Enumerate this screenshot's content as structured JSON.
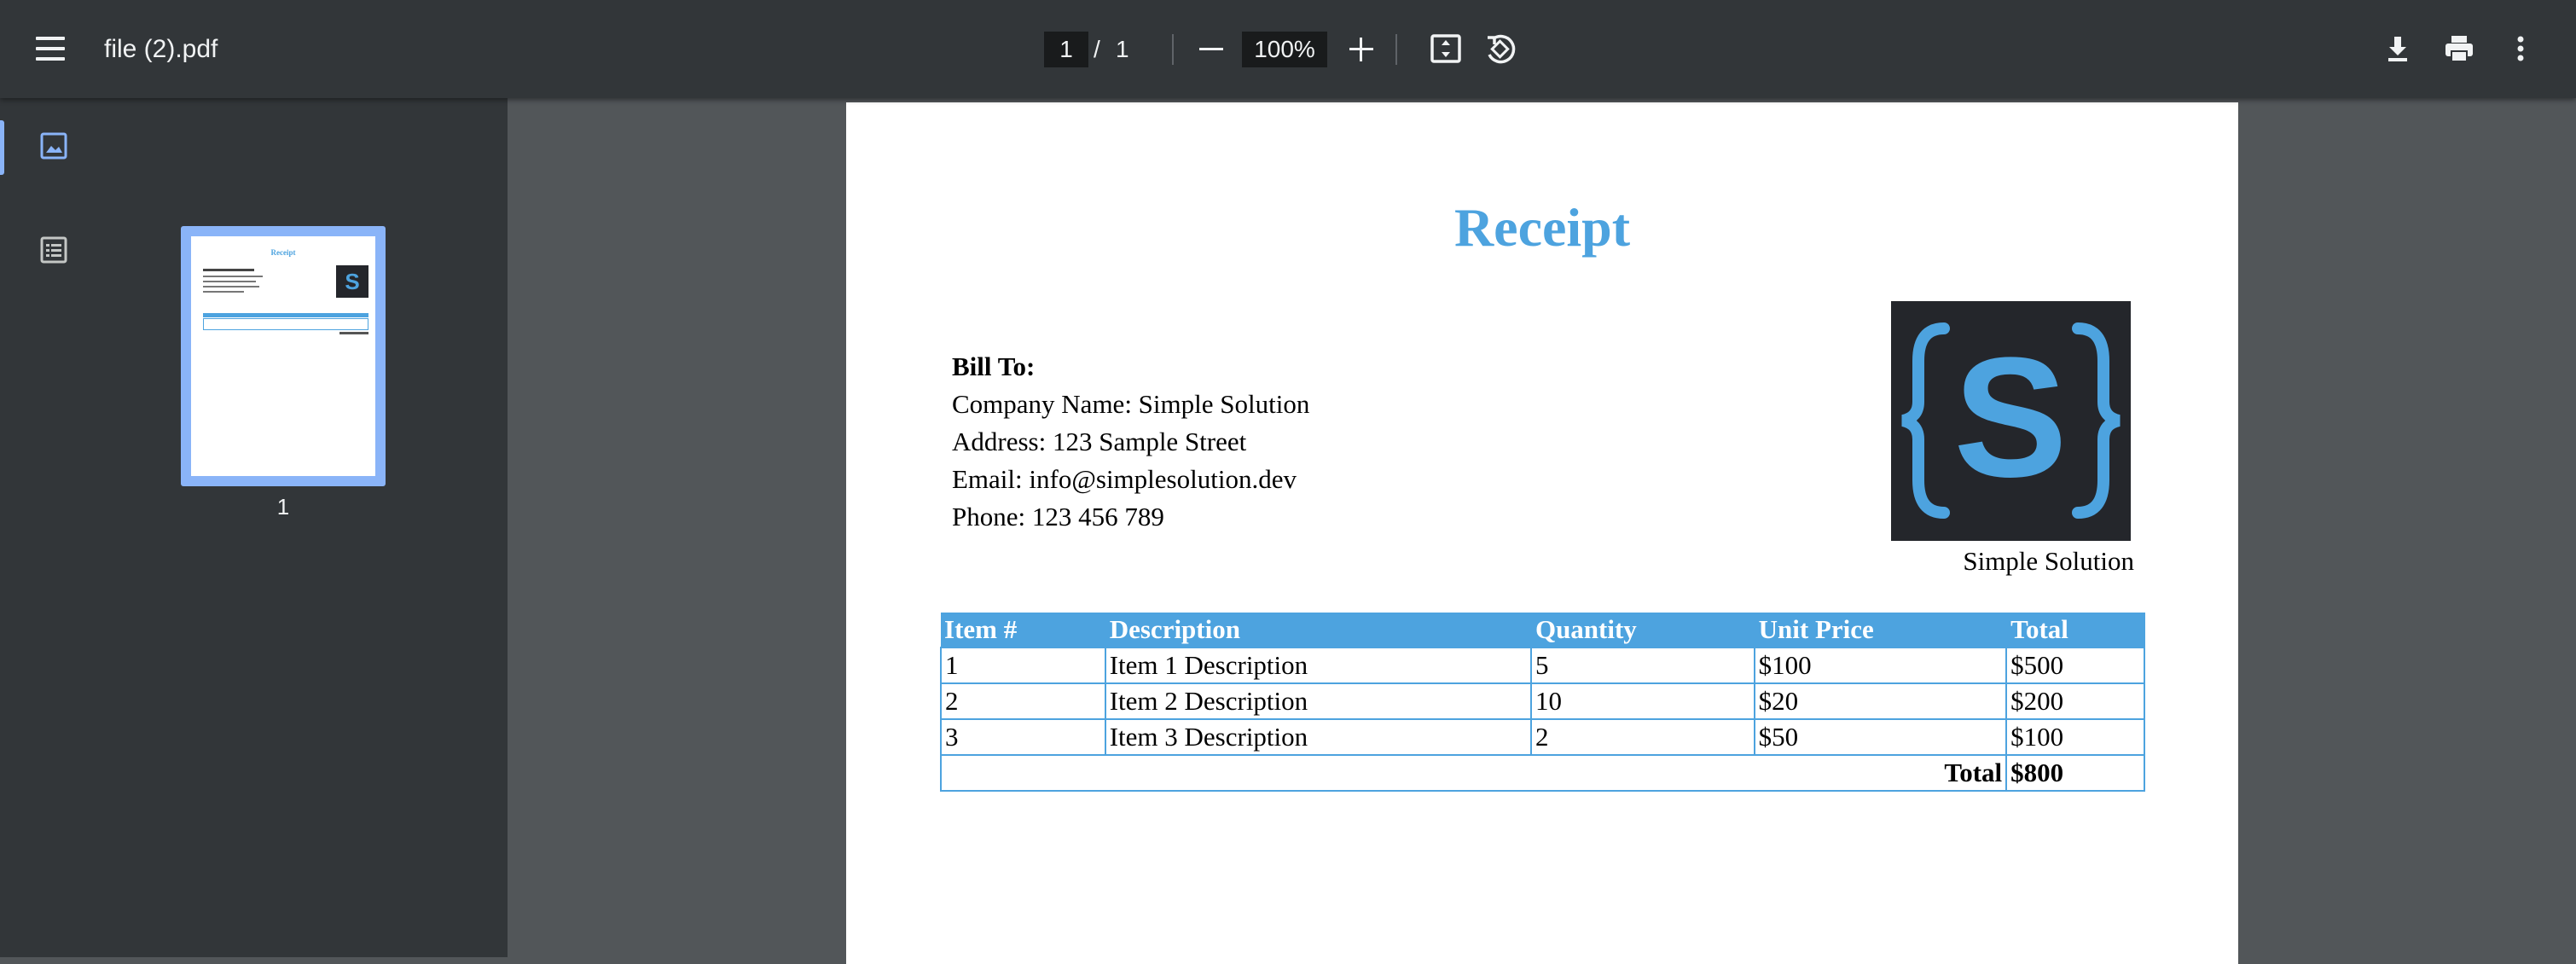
{
  "toolbar": {
    "file_name": "file (2).pdf",
    "current_page": "1",
    "page_separator": "/",
    "total_pages": "1",
    "zoom": "100%",
    "icons": [
      "menu-icon",
      "zoom-out-icon",
      "zoom-in-icon",
      "fit-page-icon",
      "rotate-icon",
      "download-icon",
      "print-icon",
      "more-vert-icon"
    ]
  },
  "sidebar": {
    "tabs": [
      {
        "name": "thumbnails",
        "icon": "image-icon",
        "active": true
      },
      {
        "name": "outline",
        "icon": "list-icon",
        "active": false
      }
    ],
    "thumbnail_page_number": "1"
  },
  "document": {
    "title": "Receipt",
    "bill_to": {
      "heading": "Bill To:",
      "lines": [
        "Company Name: Simple Solution",
        "Address: 123 Sample Street",
        "Email: info@simplesolution.dev",
        "Phone: 123 456 789"
      ]
    },
    "logo": {
      "letter": "S",
      "caption": "Simple Solution"
    },
    "table": {
      "headers": [
        "Item #",
        "Description",
        "Quantity",
        "Unit Price",
        "Total"
      ],
      "rows": [
        [
          "1",
          "Item 1 Description",
          "5",
          "$100",
          "$500"
        ],
        [
          "2",
          "Item 2 Description",
          "10",
          "$20",
          "$200"
        ],
        [
          "3",
          "Item 3 Description",
          "2",
          "$50",
          "$100"
        ]
      ],
      "total_label": "Total",
      "total_value": "$800"
    }
  },
  "colors": {
    "accent": "#4da3df",
    "toolbar_bg": "#323639",
    "viewer_bg": "#525659",
    "logo_bg": "#24262b",
    "selection": "#8ab4f8"
  }
}
